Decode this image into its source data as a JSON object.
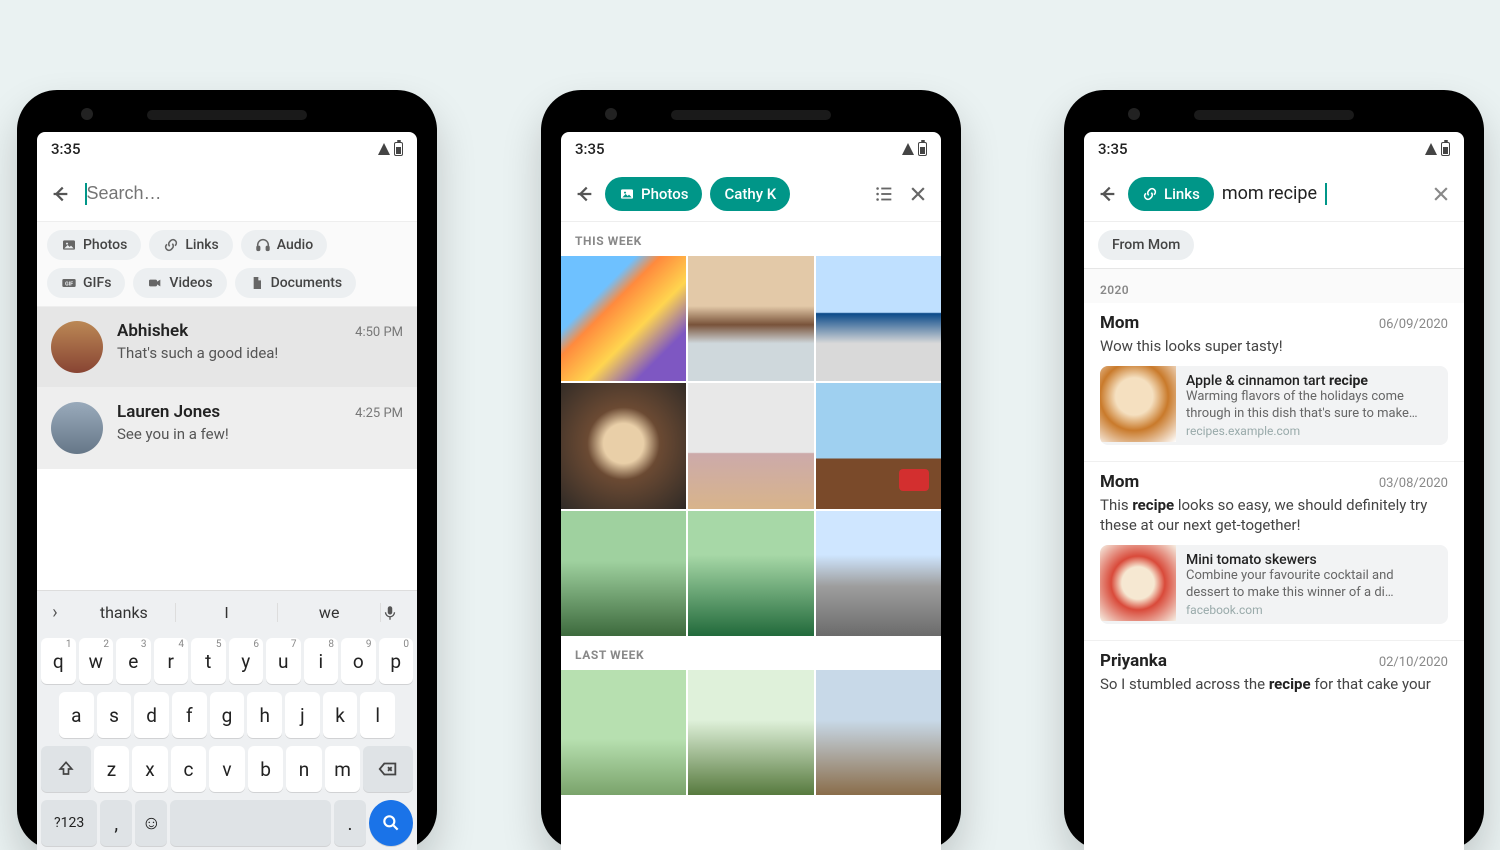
{
  "status": {
    "time": "3:35"
  },
  "phone1": {
    "search_placeholder": "Search…",
    "filters": {
      "photos": "Photos",
      "links": "Links",
      "audio": "Audio",
      "gifs": "GIFs",
      "videos": "Videos",
      "documents": "Documents"
    },
    "chats": [
      {
        "name": "Abhishek",
        "time": "4:50 PM",
        "msg": "That's such a good idea!"
      },
      {
        "name": "Lauren Jones",
        "time": "4:25 PM",
        "msg": "See you in a few!"
      }
    ],
    "keyboard": {
      "suggestions": [
        "thanks",
        "I",
        "we"
      ],
      "row1": [
        "q",
        "w",
        "e",
        "r",
        "t",
        "y",
        "u",
        "i",
        "o",
        "p"
      ],
      "row1_sup": [
        "1",
        "2",
        "3",
        "4",
        "5",
        "6",
        "7",
        "8",
        "9",
        "0"
      ],
      "row2": [
        "a",
        "s",
        "d",
        "f",
        "g",
        "h",
        "j",
        "k",
        "l"
      ],
      "row3": [
        "z",
        "x",
        "c",
        "v",
        "b",
        "n",
        "m"
      ],
      "sym": "?123",
      "comma": ",",
      "period": "."
    }
  },
  "phone2": {
    "pills": {
      "photos": "Photos",
      "contact": "Cathy K"
    },
    "sections": {
      "this_week": "THIS WEEK",
      "last_week": "LAST WEEK"
    }
  },
  "phone3": {
    "pill_links": "Links",
    "query": "mom recipe",
    "suggestion_chip": "From Mom",
    "year": "2020",
    "results": [
      {
        "name": "Mom",
        "date": "06/09/2020",
        "msg_pre": "Wow this looks super tasty!",
        "link": {
          "title_pre": "Apple & cinnamon tart ",
          "title_bold": "recipe",
          "desc": "Warming flavors of the holidays come through in this dish that's sure to make…",
          "host": "recipes.example.com"
        }
      },
      {
        "name": "Mom",
        "date": "03/08/2020",
        "msg_pre": "This ",
        "msg_bold": "recipe",
        "msg_post": " looks so easy, we should definitely try these at our next get-together!",
        "link": {
          "title_pre": "Mini tomato skewers",
          "desc": "Combine your favourite cocktail and dessert to make this winner of a di…",
          "host": "facebook.com"
        }
      },
      {
        "name": "Priyanka",
        "date": "02/10/2020",
        "msg_pre": "So I stumbled across the ",
        "msg_bold": "recipe",
        "msg_post": " for that cake your"
      }
    ]
  }
}
